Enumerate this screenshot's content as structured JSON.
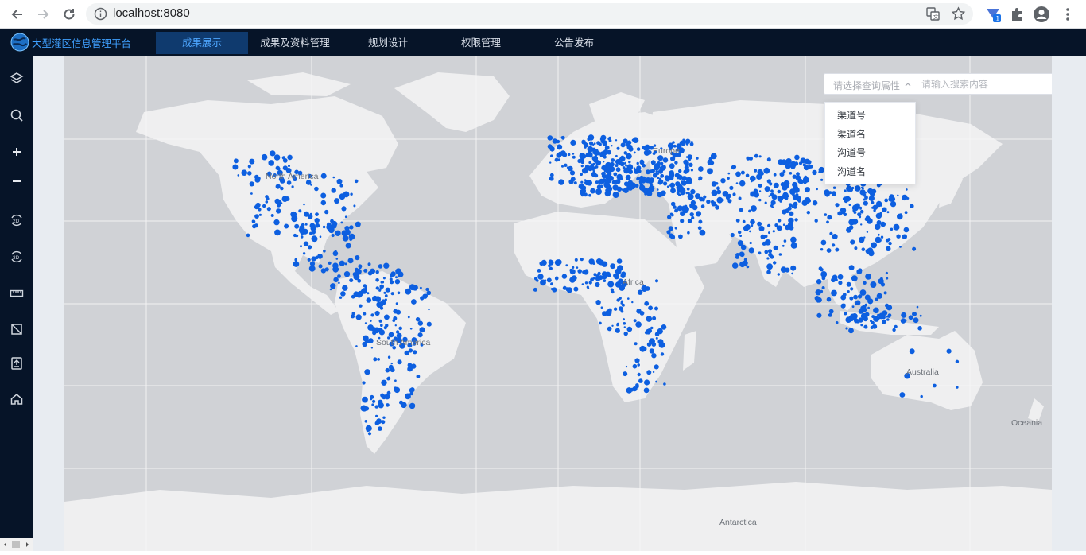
{
  "browser": {
    "url": "localhost:8080",
    "extension_badge": "1"
  },
  "app": {
    "title": "大型灌区信息管理平台",
    "accent": "#3fa0ff",
    "nav_bg": "#061428",
    "nav": [
      {
        "label": "成果展示",
        "active": true
      },
      {
        "label": "成果及资料管理",
        "active": false
      },
      {
        "label": "规划设计",
        "active": false
      },
      {
        "label": "权限管理",
        "active": false
      },
      {
        "label": "公告发布",
        "active": false
      }
    ]
  },
  "toolbar": [
    {
      "icon": "layers-icon"
    },
    {
      "icon": "search-icon"
    },
    {
      "icon": "zoom-in-icon"
    },
    {
      "icon": "zoom-out-icon"
    },
    {
      "icon": "view-2d-icon",
      "label": "2D"
    },
    {
      "icon": "view-3d-icon",
      "label": "3D"
    },
    {
      "icon": "ruler-icon"
    },
    {
      "icon": "area-measure-icon"
    },
    {
      "icon": "export-icon"
    },
    {
      "icon": "home-icon"
    }
  ],
  "search": {
    "select_placeholder": "请选择查询属性",
    "input_placeholder": "请输入搜索内容",
    "options": [
      "渠道号",
      "渠道名",
      "沟道号",
      "沟道名"
    ]
  },
  "map": {
    "labels": {
      "north_america": "North America",
      "south_america": "South America",
      "europe": "Europe",
      "africa": "Africa",
      "australia": "Australia",
      "oceania": "Oceania",
      "antarctica": "Antarctica"
    },
    "point_color": "#0d5fe0",
    "land_color": "#efeff0",
    "ocean_color": "#d0d2d6"
  }
}
